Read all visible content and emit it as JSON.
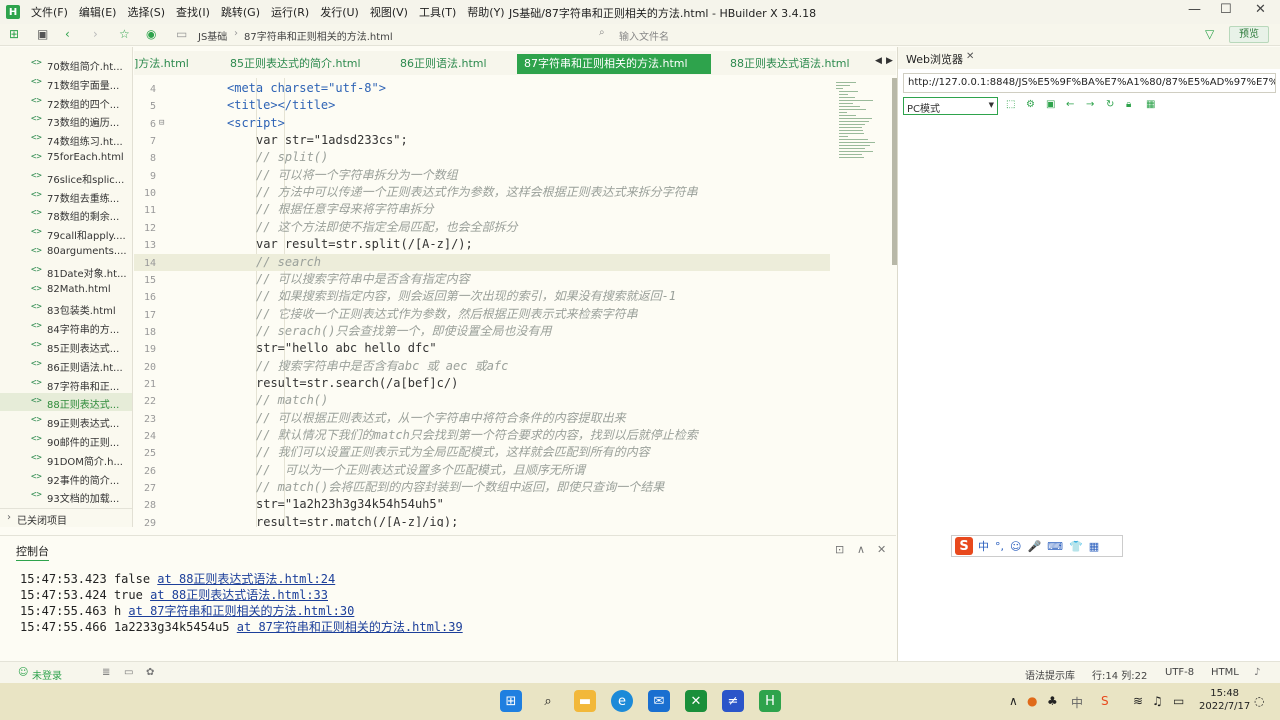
{
  "window": {
    "menu": [
      "文件(F)",
      "编辑(E)",
      "选择(S)",
      "查找(I)",
      "跳转(G)",
      "运行(R)",
      "发行(U)",
      "视图(V)",
      "工具(T)",
      "帮助(Y)"
    ],
    "title": "JS基础/87字符串和正则相关的方法.html - HBuilder X 3.4.18"
  },
  "toolbar": {
    "breadcrumb_root": "JS基础",
    "breadcrumb_file": "87字符串和正则相关的方法.html",
    "file_input_placeholder": "输入文件名",
    "preview": "预览"
  },
  "sidebar": {
    "items": [
      {
        "tag": "<>",
        "label": "70数组简介.ht..."
      },
      {
        "tag": "<>",
        "label": "71数组字面量..."
      },
      {
        "tag": "<>",
        "label": "72数组的四个..."
      },
      {
        "tag": "<>",
        "label": "73数组的遍历..."
      },
      {
        "tag": "<>",
        "label": "74数组练习.ht..."
      },
      {
        "tag": "<>",
        "label": "75forEach.html"
      },
      {
        "tag": "<>",
        "label": "76slice和splic..."
      },
      {
        "tag": "<>",
        "label": "77数组去重练..."
      },
      {
        "tag": "<>",
        "label": "78数组的剩余..."
      },
      {
        "tag": "<>",
        "label": "79call和apply...."
      },
      {
        "tag": "<>",
        "label": "80arguments...."
      },
      {
        "tag": "<>",
        "label": "81Date对象.ht..."
      },
      {
        "tag": "<>",
        "label": "82Math.html"
      },
      {
        "tag": "<>",
        "label": "83包装类.html"
      },
      {
        "tag": "<>",
        "label": "84字符串的方..."
      },
      {
        "tag": "<>",
        "label": "85正则表达式..."
      },
      {
        "tag": "<>",
        "label": "86正则语法.ht..."
      },
      {
        "tag": "<>",
        "label": "87字符串和正..."
      },
      {
        "tag": "<>",
        "label": "88正则表达式..."
      },
      {
        "tag": "<>",
        "label": "89正则表达式..."
      },
      {
        "tag": "<>",
        "label": "90邮件的正则..."
      },
      {
        "tag": "<>",
        "label": "91DOM简介.h..."
      },
      {
        "tag": "<>",
        "label": "92事件的简介..."
      },
      {
        "tag": "<>",
        "label": "93文档的加载..."
      }
    ],
    "selected_index": 18,
    "closed_items": "已关闭项目"
  },
  "tabs": {
    "items": [
      "]方法.html",
      "85正则表达式的简介.html",
      "86正则语法.html",
      "87字符串和正则相关的方法.html",
      "88正则表达式语法.html"
    ],
    "active_index": 3
  },
  "editor": {
    "current_line": 14,
    "lines": [
      {
        "n": "4",
        "text": "<meta charset=\"utf-8\">",
        "kind": "tag",
        "indent": 2
      },
      {
        "n": "5",
        "text": "<title></title>",
        "kind": "tag",
        "indent": 2
      },
      {
        "n": "6",
        "text": "<script>",
        "kind": "tag",
        "indent": 2,
        "fold": true
      },
      {
        "n": "7",
        "text": "var str=\"1adsd233cs\";",
        "kind": "code",
        "indent": 3
      },
      {
        "n": "8",
        "text": "// split()",
        "kind": "cmt",
        "indent": 3
      },
      {
        "n": "9",
        "text": "// 可以将一个字符串拆分为一个数组",
        "kind": "cmt",
        "indent": 3
      },
      {
        "n": "10",
        "text": "// 方法中可以传递一个正则表达式作为参数，这样会根据正则表达式来拆分字符串",
        "kind": "cmt",
        "indent": 3
      },
      {
        "n": "11",
        "text": "// 根据任意字母来将字符串拆分",
        "kind": "cmt",
        "indent": 3
      },
      {
        "n": "12",
        "text": "// 这个方法即使不指定全局匹配，也会全部拆分",
        "kind": "cmt",
        "indent": 3
      },
      {
        "n": "13",
        "text": "var result=str.split(/[A-z]/);",
        "kind": "code",
        "indent": 3
      },
      {
        "n": "14",
        "text": "// search",
        "kind": "cmt",
        "indent": 3
      },
      {
        "n": "15",
        "text": "// 可以搜索字符串中是否含有指定内容",
        "kind": "cmt",
        "indent": 3
      },
      {
        "n": "16",
        "text": "// 如果搜索到指定内容，则会返回第一次出现的索引，如果没有搜索就返回-1",
        "kind": "cmt",
        "indent": 3
      },
      {
        "n": "17",
        "text": "// 它接收一个正则表达式作为参数，然后根据正则表示式来检索字符串",
        "kind": "cmt",
        "indent": 3
      },
      {
        "n": "18",
        "text": "// serach()只会查找第一个，即使设置全局也没有用",
        "kind": "cmt",
        "indent": 3
      },
      {
        "n": "19",
        "text": "str=\"hello abc hello dfc\"",
        "kind": "code",
        "indent": 3
      },
      {
        "n": "20",
        "text": "// 搜索字符串中是否含有abc 或 aec 或afc",
        "kind": "cmt",
        "indent": 3
      },
      {
        "n": "21",
        "text": "result=str.search(/a[bef]c/)",
        "kind": "code",
        "indent": 3
      },
      {
        "n": "22",
        "text": "// match()",
        "kind": "cmt",
        "indent": 3
      },
      {
        "n": "23",
        "text": "// 可以根据正则表达式，从一个字符串中将符合条件的内容提取出来",
        "kind": "cmt",
        "indent": 3
      },
      {
        "n": "24",
        "text": "// 默认情况下我们的match只会找到第一个符合要求的内容，找到以后就停止检索",
        "kind": "cmt",
        "indent": 3
      },
      {
        "n": "25",
        "text": "// 我们可以设置正则表示式为全局匹配模式，这样就会匹配到所有的内容",
        "kind": "cmt",
        "indent": 3
      },
      {
        "n": "26",
        "text": "//  可以为一个正则表达式设置多个匹配模式，且顺序无所谓",
        "kind": "cmt",
        "indent": 3
      },
      {
        "n": "27",
        "text": "// match()会将匹配到的内容封装到一个数组中返回，即使只查询一个结果",
        "kind": "cmt",
        "indent": 3
      },
      {
        "n": "28",
        "text": "str=\"1a2h23h3g34k54h54uh5\"",
        "kind": "code",
        "indent": 3
      },
      {
        "n": "29",
        "text": "result=str.match(/[A-z]/ig);",
        "kind": "code",
        "indent": 3
      }
    ]
  },
  "console": {
    "title": "控制台",
    "logs": [
      {
        "time": "15:47:53.423",
        "msg": "false",
        "link": "at 88正则表达式语法.html:24"
      },
      {
        "time": "15:47:53.424",
        "msg": "true",
        "link": "at 88正则表达式语法.html:33"
      },
      {
        "time": "15:47:55.463",
        "msg": "h",
        "link": "at 87字符串和正则相关的方法.html:30"
      },
      {
        "time": "15:47:55.466",
        "msg": "1a2233g34k5454u5",
        "link": "at 87字符串和正则相关的方法.html:39"
      }
    ]
  },
  "statusbar": {
    "login": "未登录",
    "hint": "语法提示库",
    "position": "行:14  列:22",
    "encoding": "UTF-8",
    "lang": "HTML"
  },
  "browser": {
    "tab": "Web浏览器",
    "url": "http://127.0.0.1:8848/JS%E5%9F%BA%E7%A1%80/87%E5%AD%97%E7%AC%",
    "mode": "PC模式"
  },
  "ime": {
    "chars": [
      "中",
      "°,",
      "☺",
      "🎤",
      "⌨",
      "👕",
      "▦"
    ]
  },
  "taskbar": {
    "clock_time": "15:48",
    "clock_date": "2022/7/17",
    "ime_lang": "中"
  },
  "colors": {
    "accent": "#2ea34c",
    "comment": "#9aa09a",
    "tag": "#2e63b5",
    "link": "#1c3f9a"
  }
}
